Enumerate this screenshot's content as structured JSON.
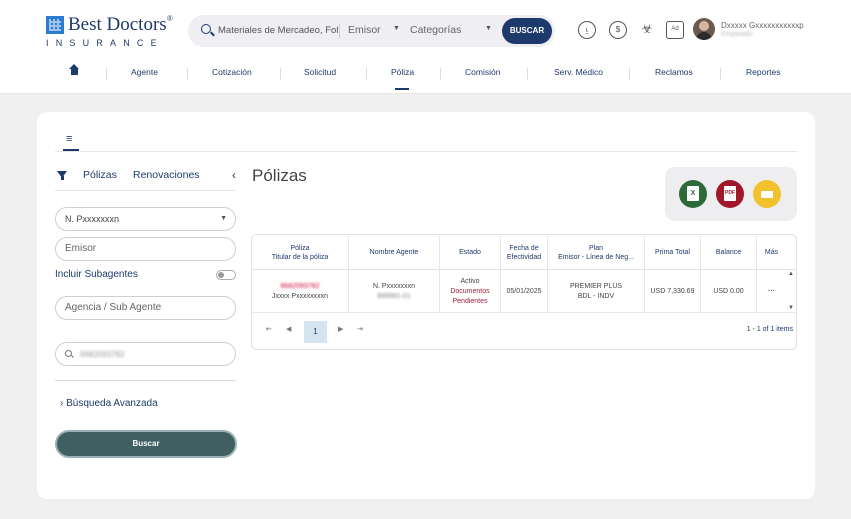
{
  "brand": {
    "name": "Best Doctors",
    "sub": "INSURANCE",
    "reg": "®"
  },
  "search": {
    "placeholder": "Materiales de Mercadeo, Foll",
    "scope": "Emisor",
    "category": "Categorías",
    "button": "BUSCAR"
  },
  "user": {
    "name": "Dxxxxx Gxxxxxxxxxxxn",
    "role": "Empleado"
  },
  "nav": [
    "Agente",
    "Cotización",
    "Solicitud",
    "Póliza",
    "Comisión",
    "Serv. Médico",
    "Reclamos",
    "Reportes"
  ],
  "nav_active": "Póliza",
  "sidebar": {
    "tab_policies": "Pólizas",
    "tab_renewals": "Renovaciones",
    "agent_select": "N. Pxxxxxxxn",
    "issuer_placeholder": "Emisor",
    "subagents_label": "Incluir Subagentes",
    "agency_placeholder": "Agencia / Sub Agente",
    "search_value": "6682093782",
    "advanced": "Búsqueda Avanzada",
    "search_button": "Buscar"
  },
  "page_title": "Pólizas",
  "exports": {
    "excel": "X",
    "pdf": "PDF"
  },
  "table": {
    "headers": [
      [
        "Póliza",
        "Titular de la póliza"
      ],
      [
        "Nombre Agente"
      ],
      [
        "Estado"
      ],
      [
        "Fecha de",
        "Efectividad"
      ],
      [
        "Plan",
        "Emisor - Línea de Neg..."
      ],
      [
        "Prima Total"
      ],
      [
        "Balance"
      ],
      [
        "Más"
      ]
    ],
    "rows": [
      {
        "policy": "6682093782",
        "holder": "Jxxxx Pxxxxxxxxn",
        "agent": "N. Pxxxxxxxn",
        "agent_code": "888881-01",
        "status": "Activo",
        "status_note_1": "Documentos",
        "status_note_2": "Pendientes",
        "effective": "05/01/2025",
        "plan": "PREMIER PLUS",
        "line": "BDL - INDV",
        "premium": "USD 7,330.69",
        "balance": "USD 0.00",
        "more": "···"
      }
    ]
  },
  "pager": {
    "current": "1",
    "info": "1 - 1 of 1 items"
  }
}
